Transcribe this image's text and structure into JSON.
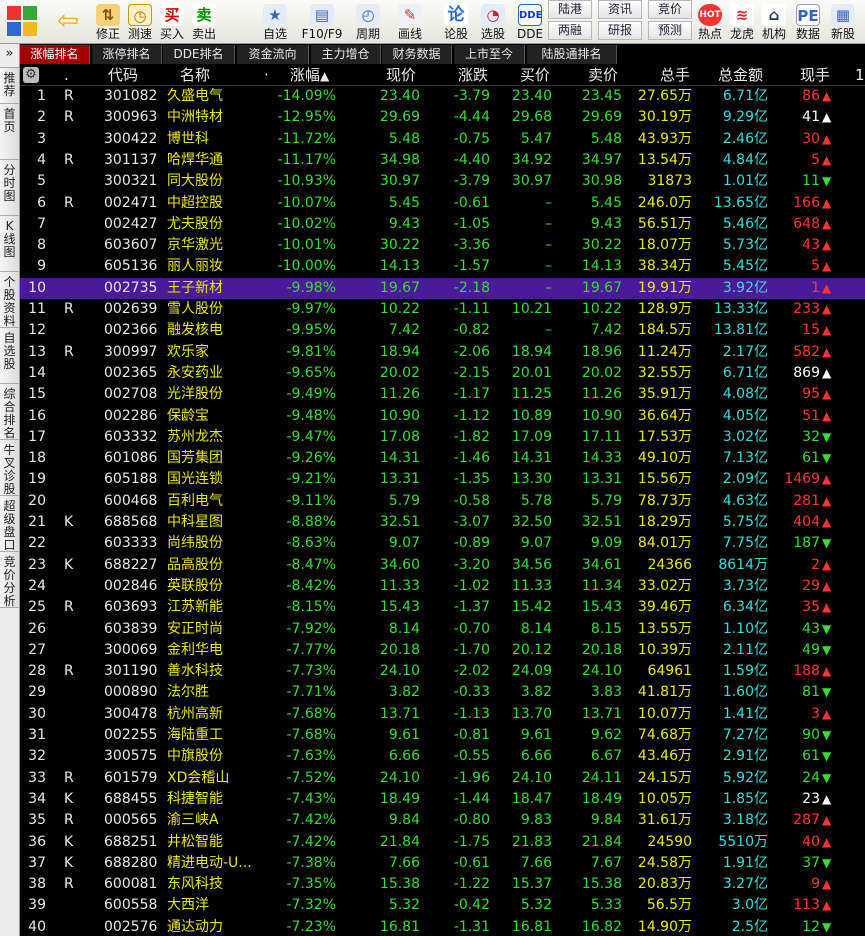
{
  "toolbar": {
    "buttons": [
      {
        "label": "修正",
        "icon": "up-down-arrows-icon"
      },
      {
        "label": "测速",
        "icon": "speed-clock-icon"
      },
      {
        "label": "买入",
        "icon": "buy-icon",
        "glyph": "买"
      },
      {
        "label": "卖出",
        "icon": "sell-icon",
        "glyph": "卖"
      },
      {
        "label": "自选",
        "icon": "favorites-icon"
      },
      {
        "label": "F10/F9",
        "icon": "f10-icon"
      },
      {
        "label": "周期",
        "icon": "period-icon"
      },
      {
        "label": "画线",
        "icon": "draw-line-icon"
      },
      {
        "label": "论股",
        "icon": "discuss-icon",
        "glyph": "论"
      },
      {
        "label": "选股",
        "icon": "stock-picker-icon"
      },
      {
        "label": "DDE",
        "icon": "dde-icon",
        "glyph": "DDE"
      },
      {
        "label": "热点",
        "icon": "hot-icon"
      },
      {
        "label": "龙虎",
        "icon": "dragon-tiger-icon"
      },
      {
        "label": "机构",
        "icon": "institution-icon"
      },
      {
        "label": "数据",
        "icon": "data-icon"
      },
      {
        "label": "新股",
        "icon": "new-stock-icon"
      }
    ],
    "small": [
      "陆港",
      "资讯",
      "竞价",
      "两融",
      "研报",
      "预测"
    ]
  },
  "sidebar": {
    "top": "»",
    "items": [
      "推荐",
      "首页",
      "分时图",
      "K线图",
      "个股资料",
      "自选股",
      "综合排名",
      "牛叉诊股",
      "超级盘口",
      "竞价分析"
    ]
  },
  "tabs": [
    "涨幅排名",
    "涨停排名",
    "DDE排名",
    "资金流向",
    "主力增仓",
    "财务数据",
    "上市至今",
    "陆股通排名"
  ],
  "header": {
    "dot": ".",
    "code": "代码",
    "name": "名称",
    "dot2": "·",
    "pct": "涨幅",
    "price": "现价",
    "chg": "涨跌",
    "bid": "买价",
    "ask": "卖价",
    "vol": "总手",
    "amt": "总金额",
    "cur": "现手",
    "extra": "1"
  },
  "colors": {
    "up": "#ff3333",
    "down": "#33dd33",
    "yellow": "#e8e800",
    "white": "#ffffff",
    "cyan": "#33dddd",
    "code": "#e8e8e8",
    "selected_row": "#4a1a9a",
    "active_tab": "#a50000"
  },
  "rows": [
    [
      "1",
      "R",
      "301082",
      "久盛电气",
      "-14.09%",
      "23.40",
      "-3.79",
      "23.40",
      "23.45",
      "27.65万",
      "6.71亿",
      "86",
      "up"
    ],
    [
      "2",
      "R",
      "300963",
      "中洲特材",
      "-12.95%",
      "29.69",
      "-4.44",
      "29.68",
      "29.69",
      "30.19万",
      "9.29亿",
      "41",
      "flat"
    ],
    [
      "3",
      "",
      "300422",
      "博世科",
      "-11.72%",
      "5.48",
      "-0.75",
      "5.47",
      "5.48",
      "43.93万",
      "2.46亿",
      "30",
      "up"
    ],
    [
      "4",
      "R",
      "301137",
      "哈焊华通",
      "-11.17%",
      "34.98",
      "-4.40",
      "34.92",
      "34.97",
      "13.54万",
      "4.84亿",
      "5",
      "up"
    ],
    [
      "5",
      "",
      "300321",
      "同大股份",
      "-10.93%",
      "30.97",
      "-3.79",
      "30.97",
      "30.98",
      "31873",
      "1.01亿",
      "11",
      "down"
    ],
    [
      "6",
      "R",
      "002471",
      "中超控股",
      "-10.07%",
      "5.45",
      "-0.61",
      "–",
      "5.45",
      "246.0万",
      "13.65亿",
      "166",
      "up"
    ],
    [
      "7",
      "",
      "002427",
      "尤夫股份",
      "-10.02%",
      "9.43",
      "-1.05",
      "–",
      "9.43",
      "56.51万",
      "5.46亿",
      "648",
      "up"
    ],
    [
      "8",
      "",
      "603607",
      "京华激光",
      "-10.01%",
      "30.22",
      "-3.36",
      "–",
      "30.22",
      "18.07万",
      "5.73亿",
      "43",
      "up"
    ],
    [
      "9",
      "",
      "605136",
      "丽人丽妆",
      "-10.00%",
      "14.13",
      "-1.57",
      "–",
      "14.13",
      "38.34万",
      "5.45亿",
      "5",
      "up"
    ],
    [
      "10",
      "",
      "002735",
      "王子新材",
      "-9.98%",
      "19.67",
      "-2.18",
      "–",
      "19.67",
      "19.91万",
      "3.92亿",
      "1",
      "up"
    ],
    [
      "11",
      "R",
      "002639",
      "雪人股份",
      "-9.97%",
      "10.22",
      "-1.11",
      "10.21",
      "10.22",
      "128.9万",
      "13.33亿",
      "233",
      "up"
    ],
    [
      "12",
      "",
      "002366",
      "融发核电",
      "-9.95%",
      "7.42",
      "-0.82",
      "–",
      "7.42",
      "184.5万",
      "13.81亿",
      "15",
      "up"
    ],
    [
      "13",
      "R",
      "300997",
      "欢乐家",
      "-9.81%",
      "18.94",
      "-2.06",
      "18.94",
      "18.96",
      "11.24万",
      "2.17亿",
      "582",
      "up"
    ],
    [
      "14",
      "",
      "002365",
      "永安药业",
      "-9.65%",
      "20.02",
      "-2.15",
      "20.01",
      "20.02",
      "32.55万",
      "6.71亿",
      "869",
      "flat"
    ],
    [
      "15",
      "",
      "002708",
      "光洋股份",
      "-9.49%",
      "11.26",
      "-1.17",
      "11.25",
      "11.26",
      "35.91万",
      "4.08亿",
      "95",
      "up"
    ],
    [
      "16",
      "",
      "002286",
      "保龄宝",
      "-9.48%",
      "10.90",
      "-1.12",
      "10.89",
      "10.90",
      "36.64万",
      "4.05亿",
      "51",
      "up"
    ],
    [
      "17",
      "",
      "603332",
      "苏州龙杰",
      "-9.47%",
      "17.08",
      "-1.82",
      "17.09",
      "17.11",
      "17.53万",
      "3.02亿",
      "32",
      "down"
    ],
    [
      "18",
      "",
      "601086",
      "国芳集团",
      "-9.26%",
      "14.31",
      "-1.46",
      "14.31",
      "14.33",
      "49.10万",
      "7.13亿",
      "61",
      "down"
    ],
    [
      "19",
      "",
      "605188",
      "国光连锁",
      "-9.21%",
      "13.31",
      "-1.35",
      "13.30",
      "13.31",
      "15.56万",
      "2.09亿",
      "1469",
      "up"
    ],
    [
      "20",
      "",
      "600468",
      "百利电气",
      "-9.11%",
      "5.79",
      "-0.58",
      "5.78",
      "5.79",
      "78.73万",
      "4.63亿",
      "281",
      "up"
    ],
    [
      "21",
      "K",
      "688568",
      "中科星图",
      "-8.88%",
      "32.51",
      "-3.07",
      "32.50",
      "32.51",
      "18.29万",
      "5.75亿",
      "404",
      "up"
    ],
    [
      "22",
      "",
      "603333",
      "尚纬股份",
      "-8.63%",
      "9.07",
      "-0.89",
      "9.07",
      "9.09",
      "84.01万",
      "7.75亿",
      "187",
      "down"
    ],
    [
      "23",
      "K",
      "688227",
      "品高股份",
      "-8.47%",
      "34.60",
      "-3.20",
      "34.56",
      "34.61",
      "24366",
      "8614万",
      "2",
      "up"
    ],
    [
      "24",
      "",
      "002846",
      "英联股份",
      "-8.42%",
      "11.33",
      "-1.02",
      "11.33",
      "11.34",
      "33.02万",
      "3.73亿",
      "29",
      "up"
    ],
    [
      "25",
      "R",
      "603693",
      "江苏新能",
      "-8.15%",
      "15.43",
      "-1.37",
      "15.42",
      "15.43",
      "39.46万",
      "6.34亿",
      "35",
      "up"
    ],
    [
      "26",
      "",
      "603839",
      "安正时尚",
      "-7.92%",
      "8.14",
      "-0.70",
      "8.14",
      "8.15",
      "13.55万",
      "1.10亿",
      "43",
      "down"
    ],
    [
      "27",
      "",
      "300069",
      "金利华电",
      "-7.77%",
      "20.18",
      "-1.70",
      "20.12",
      "20.18",
      "10.39万",
      "2.11亿",
      "49",
      "down"
    ],
    [
      "28",
      "R",
      "301190",
      "善水科技",
      "-7.73%",
      "24.10",
      "-2.02",
      "24.09",
      "24.10",
      "64961",
      "1.59亿",
      "188",
      "up"
    ],
    [
      "29",
      "",
      "000890",
      "法尔胜",
      "-7.71%",
      "3.82",
      "-0.33",
      "3.82",
      "3.83",
      "41.81万",
      "1.60亿",
      "81",
      "down"
    ],
    [
      "30",
      "",
      "300478",
      "杭州高新",
      "-7.68%",
      "13.71",
      "-1.13",
      "13.70",
      "13.71",
      "10.07万",
      "1.41亿",
      "3",
      "up"
    ],
    [
      "31",
      "",
      "002255",
      "海陆重工",
      "-7.68%",
      "9.61",
      "-0.81",
      "9.61",
      "9.62",
      "74.68万",
      "7.27亿",
      "90",
      "down"
    ],
    [
      "32",
      "",
      "300575",
      "中旗股份",
      "-7.63%",
      "6.66",
      "-0.55",
      "6.66",
      "6.67",
      "43.46万",
      "2.91亿",
      "61",
      "down"
    ],
    [
      "33",
      "R",
      "601579",
      "XD会稽山",
      "-7.52%",
      "24.10",
      "-1.96",
      "24.10",
      "24.11",
      "24.15万",
      "5.92亿",
      "24",
      "down"
    ],
    [
      "34",
      "K",
      "688455",
      "科捷智能",
      "-7.43%",
      "18.49",
      "-1.44",
      "18.47",
      "18.49",
      "10.05万",
      "1.85亿",
      "23",
      "flat"
    ],
    [
      "35",
      "R",
      "000565",
      "渝三峡A",
      "-7.42%",
      "9.84",
      "-0.80",
      "9.83",
      "9.84",
      "31.61万",
      "3.18亿",
      "287",
      "up"
    ],
    [
      "36",
      "K",
      "688251",
      "井松智能",
      "-7.42%",
      "21.84",
      "-1.75",
      "21.83",
      "21.84",
      "24590",
      "5510万",
      "40",
      "up"
    ],
    [
      "37",
      "K",
      "688280",
      "精进电动-U...",
      "-7.38%",
      "7.66",
      "-0.61",
      "7.66",
      "7.67",
      "24.58万",
      "1.91亿",
      "37",
      "down"
    ],
    [
      "38",
      "R",
      "600081",
      "东风科技",
      "-7.35%",
      "15.38",
      "-1.22",
      "15.37",
      "15.38",
      "20.83万",
      "3.27亿",
      "9",
      "up"
    ],
    [
      "39",
      "",
      "600558",
      "大西洋",
      "-7.32%",
      "5.32",
      "-0.42",
      "5.32",
      "5.33",
      "56.5万",
      "3.0亿",
      "113",
      "up"
    ],
    [
      "40",
      "",
      "002576",
      "通达动力",
      "-7.23%",
      "16.81",
      "-1.31",
      "16.81",
      "16.82",
      "14.90万",
      "2.5亿",
      "12",
      "down"
    ]
  ]
}
